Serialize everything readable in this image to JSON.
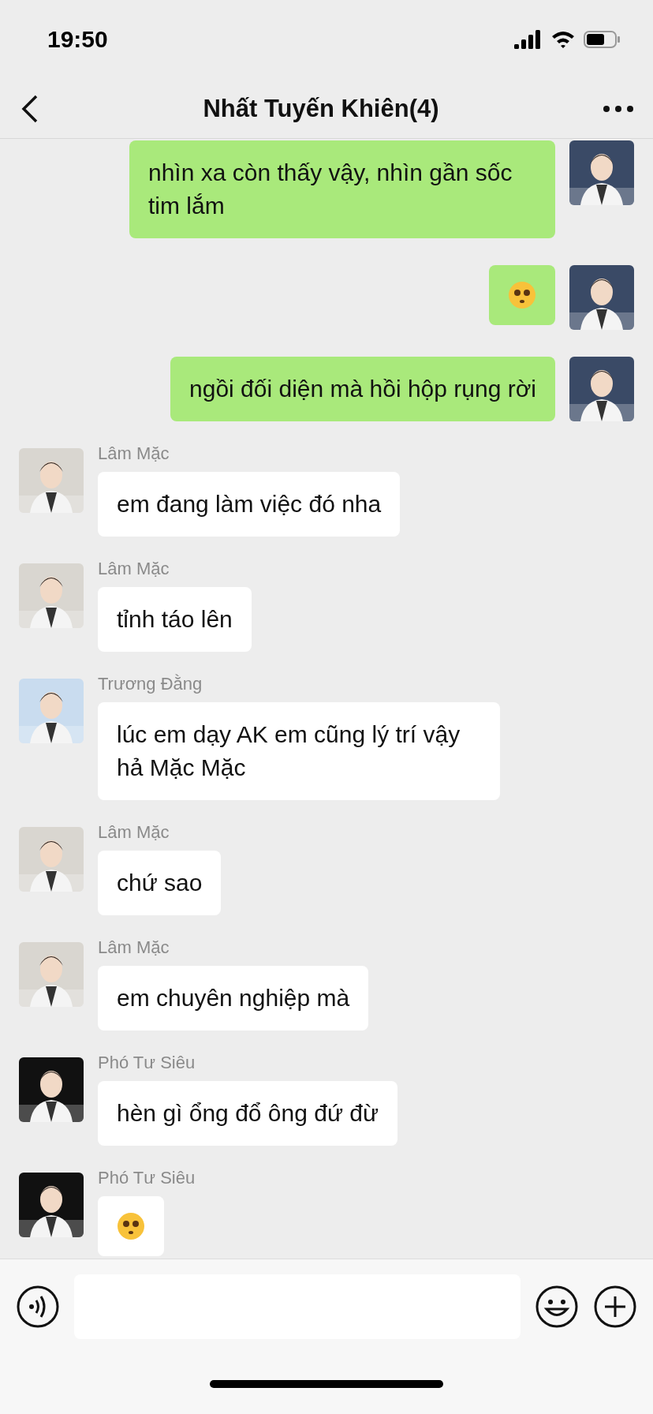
{
  "status_bar": {
    "time": "19:50"
  },
  "header": {
    "title": "Nhất Tuyến Khiên(4)"
  },
  "messages": [
    {
      "outgoing": true,
      "kind": "text",
      "text": "nhìn xa còn thấy vậy, nhìn gần sốc tim lắm",
      "color": "#3a4a66"
    },
    {
      "outgoing": true,
      "kind": "sticker",
      "color": "#3a4a66"
    },
    {
      "outgoing": true,
      "kind": "text",
      "text": "ngồi đối diện mà hồi hộp rụng rời",
      "color": "#3a4a66"
    },
    {
      "outgoing": false,
      "kind": "text",
      "sender": "Lâm Mặc",
      "text": "em đang làm việc đó nha",
      "color": "#d9d6d0"
    },
    {
      "outgoing": false,
      "kind": "text",
      "sender": "Lâm Mặc",
      "text": "tỉnh táo lên",
      "color": "#d9d6d0"
    },
    {
      "outgoing": false,
      "kind": "text",
      "sender": "Trương Đằng",
      "text": "lúc em dạy AK em cũng lý trí vậy hả Mặc Mặc",
      "color": "#c9dcef"
    },
    {
      "outgoing": false,
      "kind": "text",
      "sender": "Lâm Mặc",
      "text": "chứ sao",
      "color": "#d9d6d0"
    },
    {
      "outgoing": false,
      "kind": "text",
      "sender": "Lâm Mặc",
      "text": "em chuyên nghiệp mà",
      "color": "#d9d6d0"
    },
    {
      "outgoing": false,
      "kind": "text",
      "sender": "Phó Tư Siêu",
      "text": "hèn gì ổng đổ ông đứ đừ",
      "color": "#111111"
    },
    {
      "outgoing": false,
      "kind": "sticker",
      "sender": "Phó Tư Siêu",
      "color": "#111111"
    }
  ]
}
